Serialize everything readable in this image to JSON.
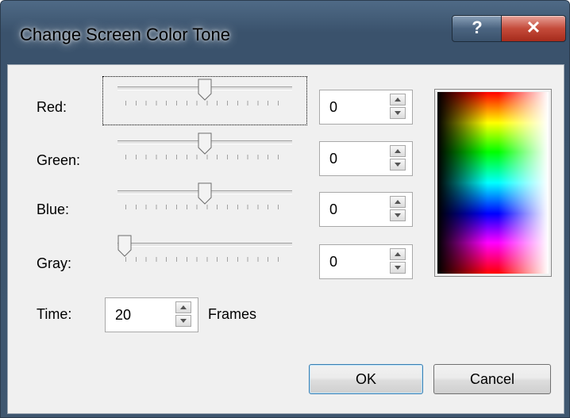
{
  "window": {
    "title": "Change Screen Color Tone",
    "help_label": "?",
    "close_label": "✕"
  },
  "sliders": [
    {
      "label": "Red:",
      "value": 0,
      "position": 0.5,
      "spin_value": "0"
    },
    {
      "label": "Green:",
      "value": 0,
      "position": 0.5,
      "spin_value": "0"
    },
    {
      "label": "Blue:",
      "value": 0,
      "position": 0.5,
      "spin_value": "0"
    },
    {
      "label": "Gray:",
      "value": 0,
      "position": 0.0,
      "spin_value": "0"
    }
  ],
  "time": {
    "label": "Time:",
    "value": "20",
    "unit": "Frames"
  },
  "buttons": {
    "ok": "OK",
    "cancel": "Cancel"
  },
  "colors": {
    "accent": "#3c7fb1",
    "titlebar": "#3f5770"
  }
}
